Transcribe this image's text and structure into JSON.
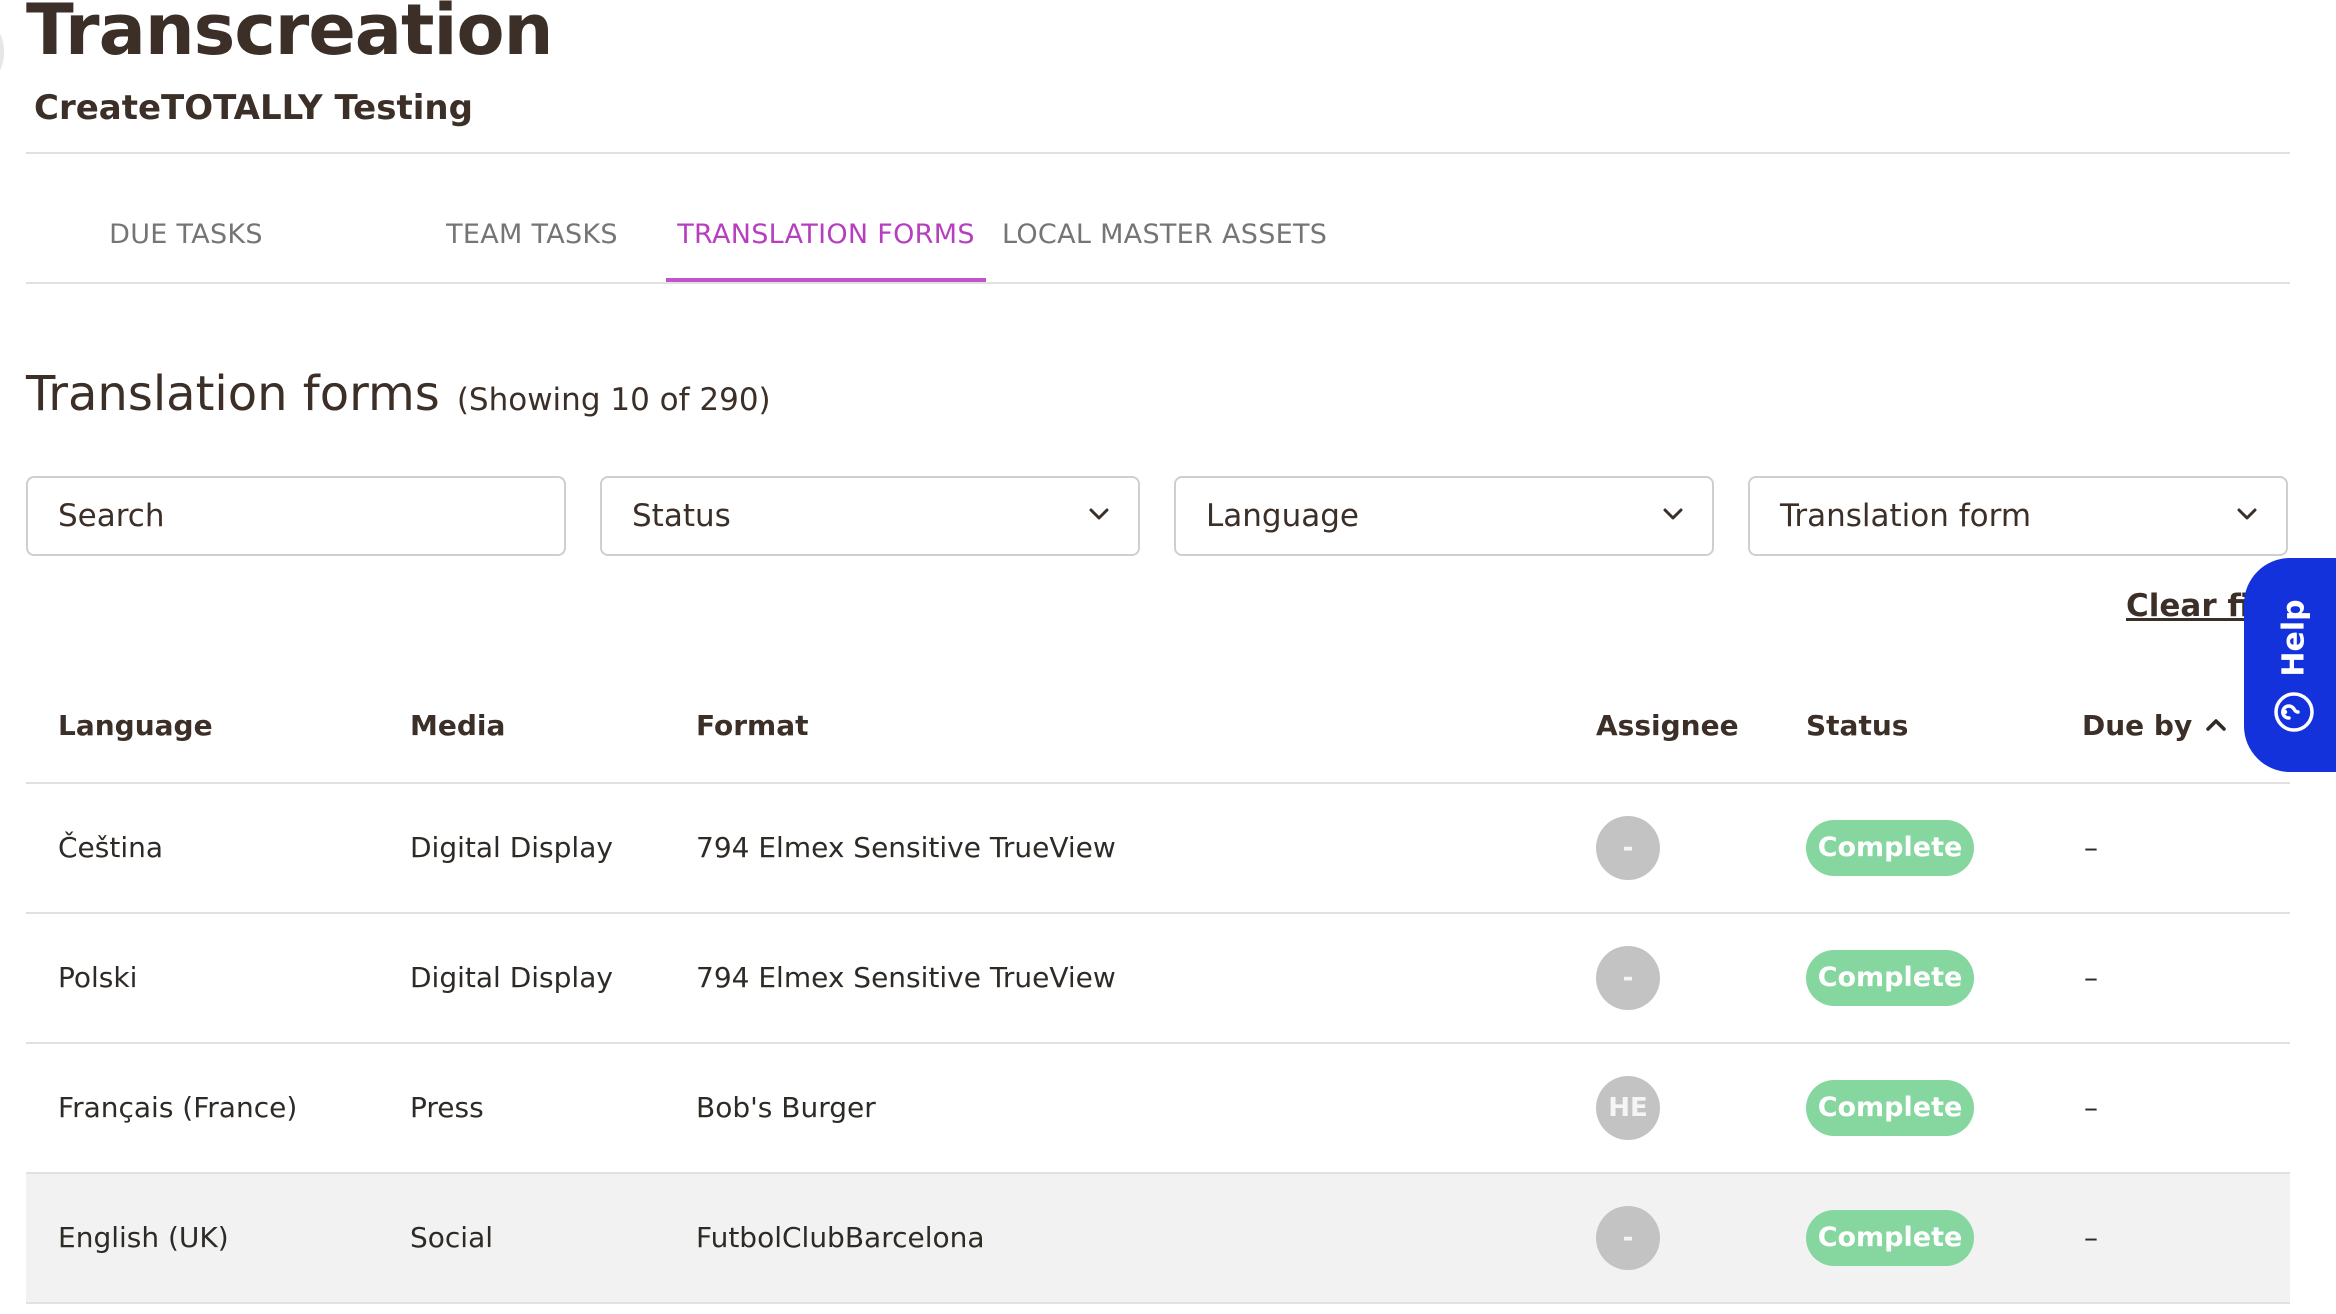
{
  "header": {
    "app_title": "Transcreation",
    "subtitle": "CreateTOTALLY Testing"
  },
  "tabs": [
    {
      "label": "DUE TASKS",
      "active": false
    },
    {
      "label": "TEAM TASKS",
      "active": false
    },
    {
      "label": "TRANSLATION FORMS",
      "active": true
    },
    {
      "label": "LOCAL MASTER ASSETS",
      "active": false
    }
  ],
  "section": {
    "title": "Translation forms",
    "count_text": "(Showing 10 of 290)"
  },
  "filters": {
    "search_placeholder": "Search",
    "status_label": "Status",
    "language_label": "Language",
    "translation_form_label": "Translation form",
    "clear_label": "Clear filt"
  },
  "table": {
    "headers": {
      "language": "Language",
      "media": "Media",
      "format": "Format",
      "assignee": "Assignee",
      "status": "Status",
      "due_by": "Due by"
    },
    "sort": {
      "column": "Due by",
      "direction": "ascending"
    },
    "rows": [
      {
        "language": "Čeština",
        "media": "Digital Display",
        "format": "794 Elmex Sensitive TrueView",
        "assignee": "-",
        "status": "Complete",
        "due_by": "–"
      },
      {
        "language": "Polski",
        "media": "Digital Display",
        "format": "794 Elmex Sensitive TrueView",
        "assignee": "-",
        "status": "Complete",
        "due_by": "–"
      },
      {
        "language": "Français (France)",
        "media": "Press",
        "format": "Bob's Burger",
        "assignee": "HE",
        "status": "Complete",
        "due_by": "–"
      },
      {
        "language": "English (UK)",
        "media": "Social",
        "format": "FutbolClubBarcelona",
        "assignee": "-",
        "status": "Complete",
        "due_by": "–"
      }
    ]
  },
  "help": {
    "label": "Help",
    "icon": "help-circle-icon"
  },
  "colors": {
    "accent": "#b63fc0",
    "status_complete": "#86d69f",
    "help_button": "#1432dc",
    "avatar": "#c3c3c3",
    "title_text": "#3b2f28"
  }
}
